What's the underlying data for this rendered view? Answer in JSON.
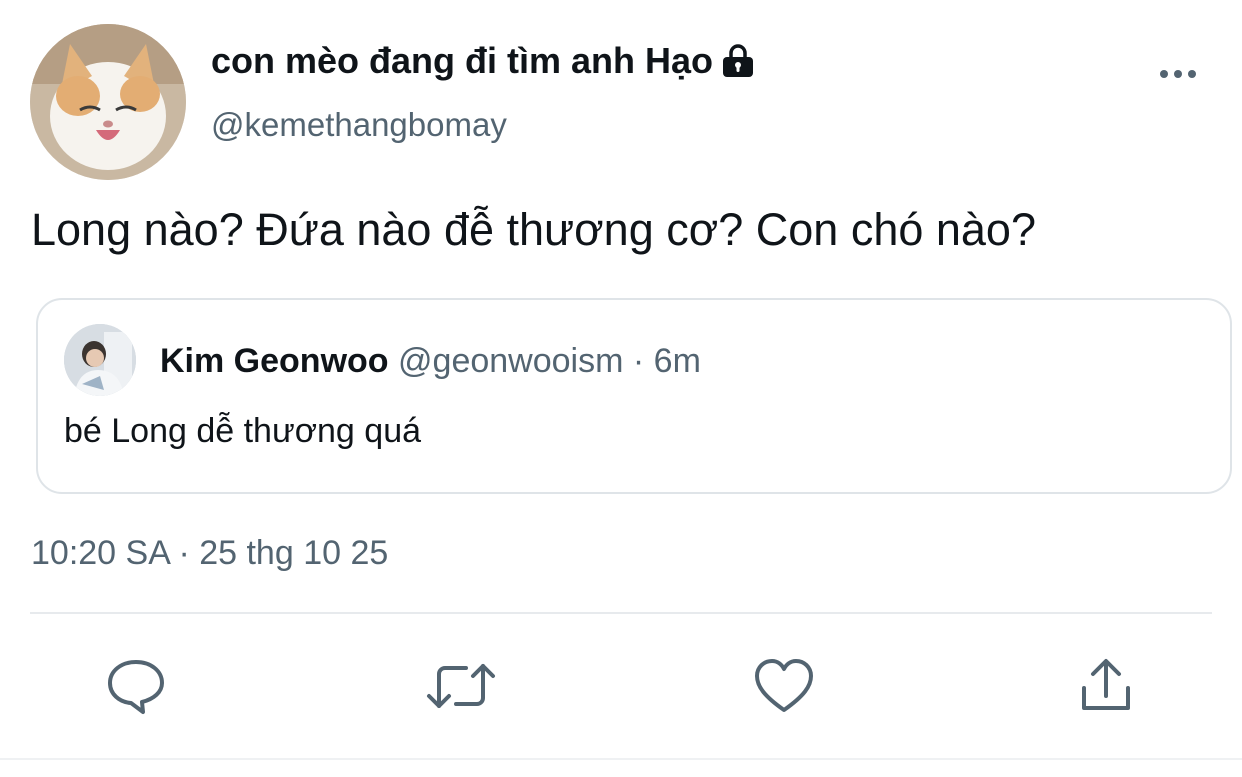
{
  "author": {
    "display_name": "con mèo đang đi tìm anh Hạo",
    "handle": "@kemethangbomay",
    "avatar_icon": "cat-avatar",
    "lock_icon": "lock-icon"
  },
  "tweet": {
    "text": "Long nào? Đứa nào đễ thương cơ? Con chó nào?",
    "timestamp": "10:20 SA · 25 thg 10 25"
  },
  "quoted_tweet": {
    "name": "Kim Geonwoo",
    "handle": "@geonwooism",
    "separator": "·",
    "time": "6m",
    "text": "bé Long dễ thương quá"
  },
  "actions": [
    {
      "icon": "reply-icon"
    },
    {
      "icon": "retweet-icon"
    },
    {
      "icon": "like-icon"
    },
    {
      "icon": "share-icon"
    }
  ],
  "colors": {
    "primary_text": "#0f1419",
    "secondary_text": "#536471",
    "border": "#dfe4e8",
    "icon": "#536471"
  }
}
